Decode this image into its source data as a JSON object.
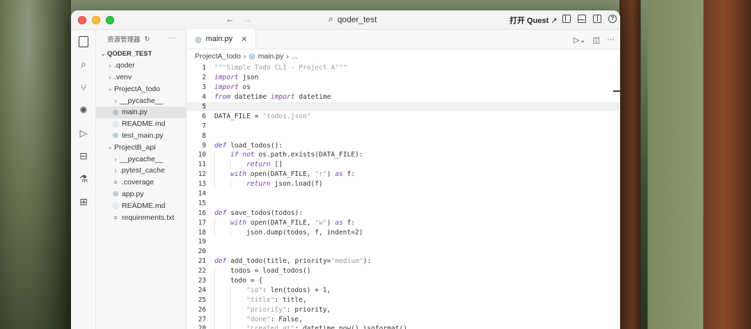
{
  "window": {
    "search_title": "qoder_test",
    "quest_label": "打开 Quest",
    "quest_arrow": "↗"
  },
  "sidebar": {
    "header": "资源管理器",
    "root": "QODER_TEST",
    "items": [
      {
        "label": ".qoder",
        "kind": "folder",
        "expanded": false,
        "depth": 1
      },
      {
        "label": ".venv",
        "kind": "folder",
        "expanded": false,
        "depth": 1
      },
      {
        "label": "ProjectA_todo",
        "kind": "folder",
        "expanded": true,
        "depth": 1
      },
      {
        "label": "__pycache__",
        "kind": "folder",
        "expanded": false,
        "depth": 2
      },
      {
        "label": "main.py",
        "kind": "py",
        "depth": 2,
        "selected": true
      },
      {
        "label": "README.md",
        "kind": "md",
        "depth": 2
      },
      {
        "label": "test_main.py",
        "kind": "py",
        "depth": 2
      },
      {
        "label": "ProjectB_api",
        "kind": "folder",
        "expanded": true,
        "depth": 1
      },
      {
        "label": "__pycache__",
        "kind": "folder",
        "expanded": false,
        "depth": 2
      },
      {
        "label": ".pytest_cache",
        "kind": "folder",
        "expanded": false,
        "depth": 2
      },
      {
        "label": ".coverage",
        "kind": "txt",
        "depth": 2
      },
      {
        "label": "app.py",
        "kind": "py",
        "depth": 2
      },
      {
        "label": "README.md",
        "kind": "md",
        "depth": 2
      },
      {
        "label": "requirements.txt",
        "kind": "txt",
        "depth": 2
      }
    ]
  },
  "editor": {
    "tab_label": "main.py",
    "breadcrumb": [
      "ProjectA_todo",
      "main.py",
      "..."
    ],
    "current_line": 5,
    "lines": [
      {
        "n": "1",
        "indent": 0,
        "tokens": [
          {
            "t": "\"\"\"Simple Todo CLI - Project A\"\"\"",
            "c": "str"
          }
        ]
      },
      {
        "n": "2",
        "indent": 0,
        "tokens": [
          {
            "t": "import",
            "c": "kw"
          },
          {
            "t": " json",
            "c": ""
          }
        ]
      },
      {
        "n": "3",
        "indent": 0,
        "tokens": [
          {
            "t": "import",
            "c": "kw"
          },
          {
            "t": " os",
            "c": ""
          }
        ]
      },
      {
        "n": "4",
        "indent": 0,
        "tokens": [
          {
            "t": "from",
            "c": "kw"
          },
          {
            "t": " datetime ",
            "c": ""
          },
          {
            "t": "import",
            "c": "kw"
          },
          {
            "t": " datetime",
            "c": ""
          }
        ]
      },
      {
        "n": "5",
        "indent": 0,
        "tokens": []
      },
      {
        "n": "6",
        "indent": 0,
        "tokens": [
          {
            "t": "DATA_FILE = ",
            "c": ""
          },
          {
            "t": "\"todos.json\"",
            "c": "str"
          }
        ]
      },
      {
        "n": "7",
        "indent": 0,
        "tokens": []
      },
      {
        "n": "8",
        "indent": 0,
        "tokens": []
      },
      {
        "n": "9",
        "indent": 0,
        "tokens": [
          {
            "t": "def",
            "c": "kw"
          },
          {
            "t": " load_todos():",
            "c": ""
          }
        ]
      },
      {
        "n": "10",
        "indent": 1,
        "tokens": [
          {
            "t": "if not",
            "c": "kw"
          },
          {
            "t": " os.path.exists(DATA_FILE):",
            "c": ""
          }
        ]
      },
      {
        "n": "11",
        "indent": 2,
        "tokens": [
          {
            "t": "return",
            "c": "kw"
          },
          {
            "t": " []",
            "c": ""
          }
        ]
      },
      {
        "n": "12",
        "indent": 1,
        "tokens": [
          {
            "t": "with",
            "c": "kw"
          },
          {
            "t": " open(DATA_FILE, ",
            "c": ""
          },
          {
            "t": "\"r\"",
            "c": "str"
          },
          {
            "t": ") ",
            "c": ""
          },
          {
            "t": "as",
            "c": "kw"
          },
          {
            "t": " f:",
            "c": ""
          }
        ]
      },
      {
        "n": "13",
        "indent": 2,
        "tokens": [
          {
            "t": "return",
            "c": "kw"
          },
          {
            "t": " json.load(f)",
            "c": ""
          }
        ]
      },
      {
        "n": "14",
        "indent": 0,
        "tokens": []
      },
      {
        "n": "15",
        "indent": 0,
        "tokens": []
      },
      {
        "n": "16",
        "indent": 0,
        "tokens": [
          {
            "t": "def",
            "c": "kw"
          },
          {
            "t": " save_todos(todos):",
            "c": ""
          }
        ]
      },
      {
        "n": "17",
        "indent": 1,
        "tokens": [
          {
            "t": "with",
            "c": "kw"
          },
          {
            "t": " open(DATA_FILE, ",
            "c": ""
          },
          {
            "t": "\"w\"",
            "c": "str"
          },
          {
            "t": ") ",
            "c": ""
          },
          {
            "t": "as",
            "c": "kw"
          },
          {
            "t": " f:",
            "c": ""
          }
        ]
      },
      {
        "n": "18",
        "indent": 2,
        "tokens": [
          {
            "t": "json.dump(todos, f, indent=2)",
            "c": ""
          }
        ]
      },
      {
        "n": "19",
        "indent": 0,
        "tokens": []
      },
      {
        "n": "20",
        "indent": 0,
        "tokens": []
      },
      {
        "n": "21",
        "indent": 0,
        "tokens": [
          {
            "t": "def",
            "c": "kw"
          },
          {
            "t": " add_todo(title, priority=",
            "c": ""
          },
          {
            "t": "\"medium\"",
            "c": "str"
          },
          {
            "t": "):",
            "c": ""
          }
        ]
      },
      {
        "n": "22",
        "indent": 1,
        "tokens": [
          {
            "t": "todos = load_todos()",
            "c": ""
          }
        ]
      },
      {
        "n": "23",
        "indent": 1,
        "tokens": [
          {
            "t": "todo = {",
            "c": ""
          }
        ]
      },
      {
        "n": "24",
        "indent": 2,
        "tokens": [
          {
            "t": "\"id\"",
            "c": "str"
          },
          {
            "t": ": len(todos) + 1,",
            "c": ""
          }
        ]
      },
      {
        "n": "25",
        "indent": 2,
        "tokens": [
          {
            "t": "\"title\"",
            "c": "str"
          },
          {
            "t": ": title,",
            "c": ""
          }
        ]
      },
      {
        "n": "26",
        "indent": 2,
        "tokens": [
          {
            "t": "\"priority\"",
            "c": "str"
          },
          {
            "t": ": priority,",
            "c": ""
          }
        ]
      },
      {
        "n": "27",
        "indent": 2,
        "tokens": [
          {
            "t": "\"done\"",
            "c": "str"
          },
          {
            "t": ": False,",
            "c": ""
          }
        ]
      },
      {
        "n": "28",
        "indent": 2,
        "tokens": [
          {
            "t": "\"created_at\"",
            "c": "str"
          },
          {
            "t": ": datetime.now().isoformat()",
            "c": ""
          }
        ]
      }
    ]
  }
}
